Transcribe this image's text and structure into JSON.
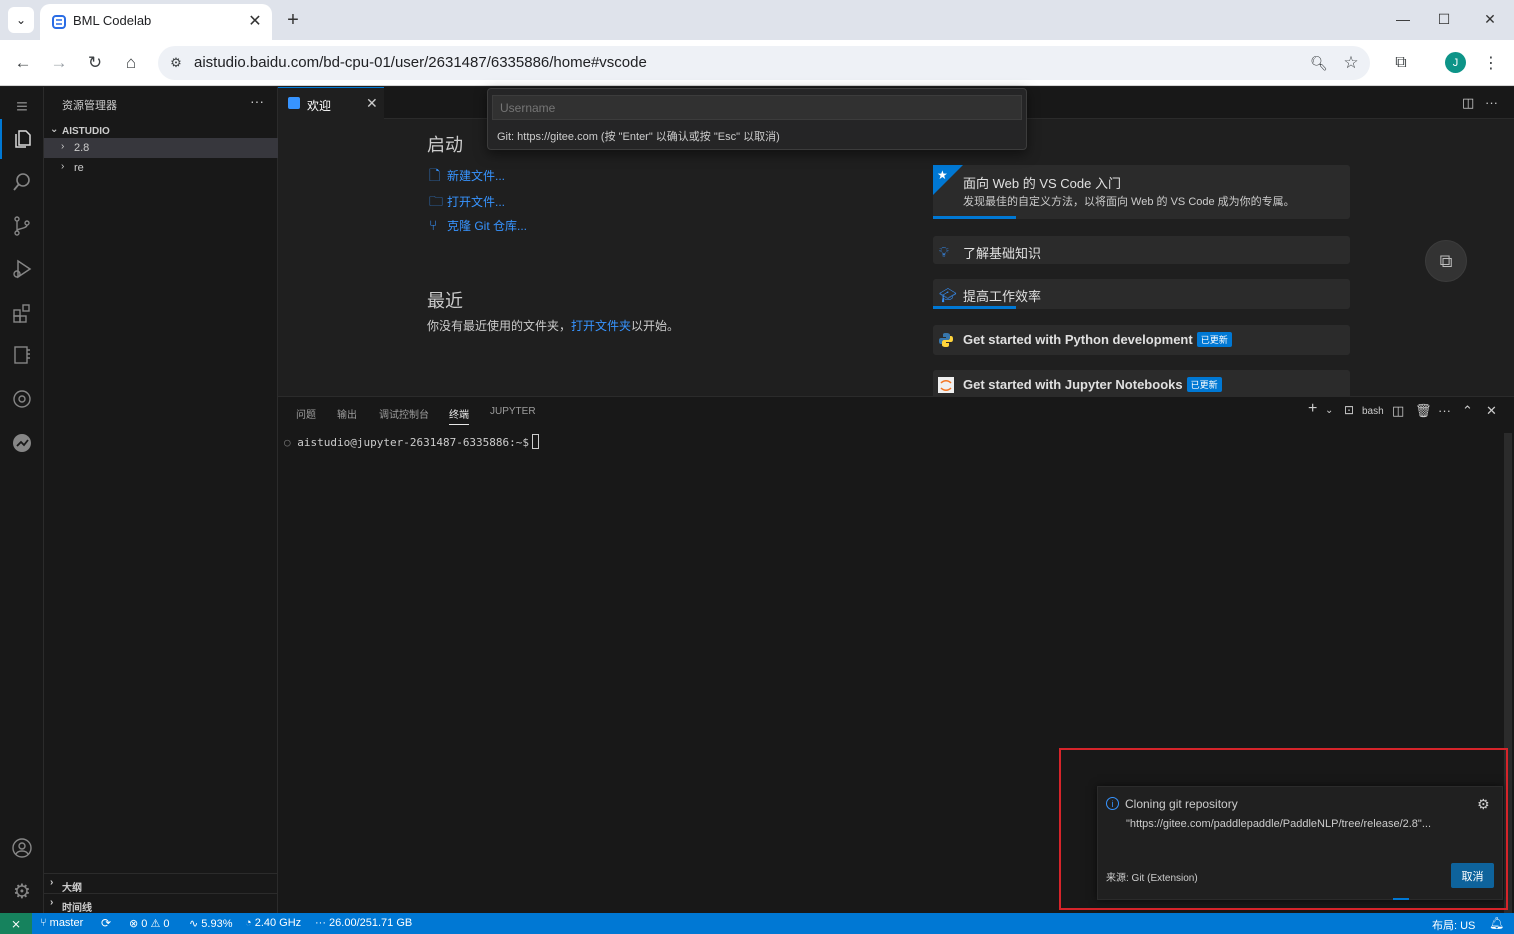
{
  "browser": {
    "tab_title": "BML Codelab",
    "url": "aistudio.baidu.com/bd-cpu-01/user/2631487/6335886/home#vscode",
    "profile_initial": "J"
  },
  "sidebar": {
    "header": "资源管理器",
    "root": "AISTUDIO",
    "items": [
      {
        "label": "2.8"
      },
      {
        "label": "re"
      }
    ],
    "outline": "大纲",
    "timeline": "时间线"
  },
  "editor": {
    "tab_label": "欢迎"
  },
  "quick_input": {
    "placeholder": "Username",
    "hint": "Git: https://gitee.com (按 \"Enter\" 以确认或按 \"Esc\" 以取消)"
  },
  "welcome": {
    "start_heading": "启动",
    "start_links": [
      {
        "label": "新建文件..."
      },
      {
        "label": "打开文件..."
      },
      {
        "label": "克隆 Git 仓库..."
      }
    ],
    "recent_heading": "最近",
    "recent_text_pre": "你没有最近使用的文件夹，",
    "recent_link": "打开文件夹",
    "recent_text_post": "以开始。",
    "walkthroughs": [
      {
        "title": "面向 Web 的 VS Code 入门",
        "desc": "发现最佳的自定义方法，以将面向 Web 的 VS Code 成为你的专属。",
        "progress": 0.2
      },
      {
        "title": "了解基础知识"
      },
      {
        "title": "提高工作效率",
        "progress": 0.2
      },
      {
        "title": "Get started with Python development",
        "badge": "已更新"
      },
      {
        "title": "Get started with Jupyter Notebooks",
        "badge": "已更新"
      }
    ]
  },
  "panel": {
    "tabs": [
      "问题",
      "输出",
      "调试控制台",
      "终端",
      "JUPYTER"
    ],
    "active_tab": "终端",
    "shell": "bash",
    "prompt": "aistudio@jupyter-2631487-6335886:~$"
  },
  "notification": {
    "title": "Cloning git repository",
    "url": "\"https://gitee.com/paddlepaddle/PaddleNLP/tree/release/2.8\"...",
    "source": "来源: Git (Extension)",
    "cancel_label": "取消"
  },
  "statusbar": {
    "branch": "master",
    "errors": "0",
    "warnings": "0",
    "cpu": "5.93%",
    "freq": "2.40 GHz",
    "memory": "26.00/251.71 GB",
    "layout": "布局: US"
  }
}
